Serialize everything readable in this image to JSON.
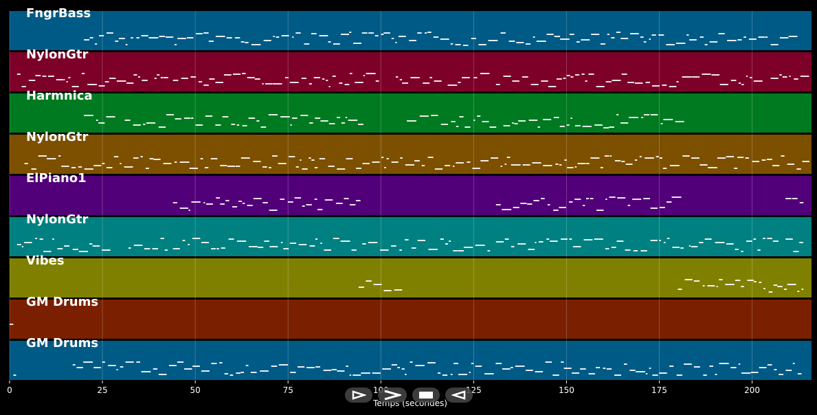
{
  "axis": {
    "xlabel": "Temps (secondes)",
    "xlim": [
      0,
      216
    ],
    "ticks": [
      "0",
      "25",
      "50",
      "75",
      "100",
      "125",
      "150",
      "175",
      "200"
    ]
  },
  "tracks": [
    {
      "name": "FngrBass",
      "color": "#005a86"
    },
    {
      "name": "NylonGtr",
      "color": "#7d0028"
    },
    {
      "name": "Harmnica",
      "color": "#007a20"
    },
    {
      "name": "NylonGtr",
      "color": "#7d5000"
    },
    {
      "name": "ElPiano1",
      "color": "#52007a"
    },
    {
      "name": "NylonGtr",
      "color": "#008080"
    },
    {
      "name": "Vibes",
      "color": "#808000"
    },
    {
      "name": "GM Drums",
      "color": "#7a2000"
    },
    {
      "name": "GM Drums",
      "color": "#005a86"
    }
  ],
  "transport": {
    "play_icon": "play-icon",
    "forward_icon": "fast-forward-icon",
    "stop_icon": "stop-icon",
    "back_icon": "rewind-icon"
  }
}
